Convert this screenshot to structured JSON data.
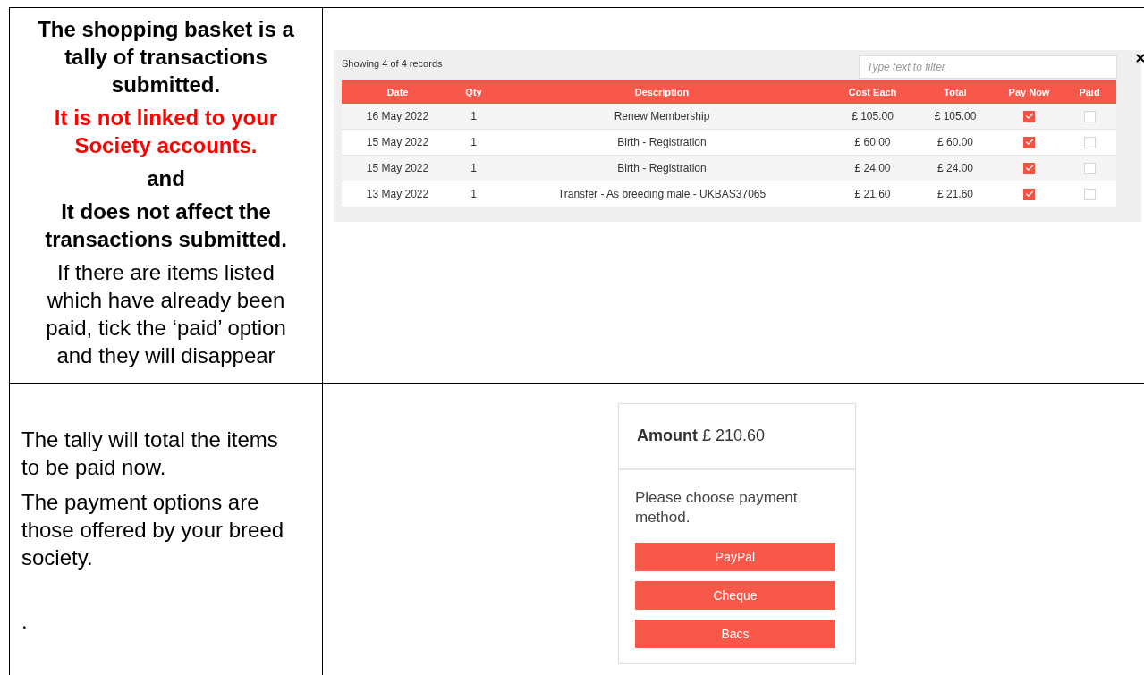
{
  "top_row": {
    "notes": [
      {
        "kind": "bold",
        "text": "The shopping basket is a tally of transactions submitted."
      },
      {
        "kind": "warning",
        "text": "It is not linked to your Society accounts."
      },
      {
        "kind": "bold",
        "text": "and"
      },
      {
        "kind": "bold",
        "text": "It does not affect the transactions submitted."
      },
      {
        "kind": "plain",
        "text": "If there are items listed which have already been paid, tick the ‘paid’ option and they will disappear"
      }
    ],
    "basket": {
      "record_count": "Showing 4 of 4 records",
      "filter": {
        "placeholder": "Type text to filter"
      },
      "columns": [
        "Date",
        "Qty",
        "Description",
        "Cost Each",
        "Total",
        "Pay Now",
        "Paid"
      ],
      "rows": [
        {
          "date": "16 May 2022",
          "qty": "1",
          "description": "Renew Membership",
          "cost_each": "£ 105.00",
          "total": "£ 105.00",
          "pay_now": true,
          "paid": false
        },
        {
          "date": "15 May 2022",
          "qty": "1",
          "description": "Birth - Registration",
          "cost_each": "£ 60.00",
          "total": "£ 60.00",
          "pay_now": true,
          "paid": false
        },
        {
          "date": "15 May 2022",
          "qty": "1",
          "description": "Birth - Registration",
          "cost_each": "£ 24.00",
          "total": "£ 24.00",
          "pay_now": true,
          "paid": false
        },
        {
          "date": "13 May 2022",
          "qty": "1",
          "description": "Transfer - As breeding male - UKBAS37065",
          "cost_each": "£ 21.60",
          "total": "£ 21.60",
          "pay_now": true,
          "paid": false
        }
      ]
    }
  },
  "bottom_row": {
    "notes": [
      "The tally will total the items to be paid now.",
      "The payment options are those offered by your breed society."
    ],
    "trailing_mark": ".",
    "payment": {
      "amount": "**Amount** £ 210.60",
      "prompt": "Please choose payment method.",
      "methods": [
        "PayPal",
        "Cheque",
        "Bacs"
      ]
    }
  }
}
